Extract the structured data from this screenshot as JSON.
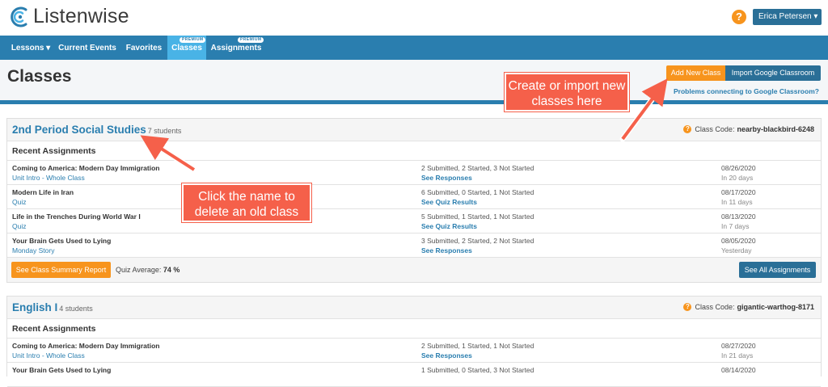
{
  "brand": {
    "name": "Listenwise"
  },
  "topbar": {
    "help_glyph": "?",
    "user_label": "Erica Petersen ▾"
  },
  "nav": {
    "items": [
      {
        "label": "Lessons ▾"
      },
      {
        "label": "Current Events"
      },
      {
        "label": "Favorites"
      },
      {
        "label": "Classes",
        "badge": "PREMIUM"
      },
      {
        "label": "Assignments",
        "badge": "PREMIUM"
      }
    ]
  },
  "header": {
    "title": "Classes",
    "add_label": "Add New Class",
    "import_label": "Import Google Classroom",
    "problems_link": "Problems connecting to Google Classroom?"
  },
  "classes": [
    {
      "name": "2nd Period Social Studies",
      "students": "7 students",
      "code_label": "Class Code:",
      "code": "nearby-blackbird-6248",
      "recent_label": "Recent Assignments",
      "assignments": [
        {
          "title": "Coming to America: Modern Day Immigration",
          "sub": "Unit Intro - Whole Class",
          "status": "2 Submitted, 2 Started, 3 Not Started",
          "link": "See Responses",
          "date": "08/26/2020",
          "due": "In 20 days"
        },
        {
          "title": "Modern Life in Iran",
          "sub": "Quiz",
          "status": "6 Submitted, 0 Started, 1 Not Started",
          "link": "See Quiz Results",
          "date": "08/17/2020",
          "due": "In 11 days"
        },
        {
          "title": "Life in the Trenches During World War I",
          "sub": "Quiz",
          "status": "5 Submitted, 1 Started, 1 Not Started",
          "link": "See Quiz Results",
          "date": "08/13/2020",
          "due": "In 7 days"
        },
        {
          "title": "Your Brain Gets Used to Lying",
          "sub": "Monday Story",
          "status": "3 Submitted, 2 Started, 2 Not Started",
          "link": "See Responses",
          "date": "08/05/2020",
          "due": "Yesterday"
        }
      ],
      "summary_label": "See Class Summary Report",
      "quiz_avg_label": "Quiz Average:",
      "quiz_avg_value": "74 %",
      "all_label": "See All Assignments"
    },
    {
      "name": "English I",
      "students": "4 students",
      "code_label": "Class Code:",
      "code": "gigantic-warthog-8171",
      "recent_label": "Recent Assignments",
      "assignments": [
        {
          "title": "Coming to America: Modern Day Immigration",
          "sub": "Unit Intro - Whole Class",
          "status": "2 Submitted, 1 Started, 1 Not Started",
          "link": "See Responses",
          "date": "08/27/2020",
          "due": "In 21 days"
        },
        {
          "title": "Your Brain Gets Used to Lying",
          "sub": "",
          "status": "1 Submitted, 0 Started, 3 Not Started",
          "link": "",
          "date": "08/14/2020",
          "due": ""
        }
      ]
    }
  ],
  "annotations": {
    "create_note": "Create or import new classes here",
    "delete_note": "Click the name to delete an old class"
  },
  "colors": {
    "primary": "#2a7eaf",
    "accent": "#f7941d",
    "callout": "#f5604a"
  }
}
